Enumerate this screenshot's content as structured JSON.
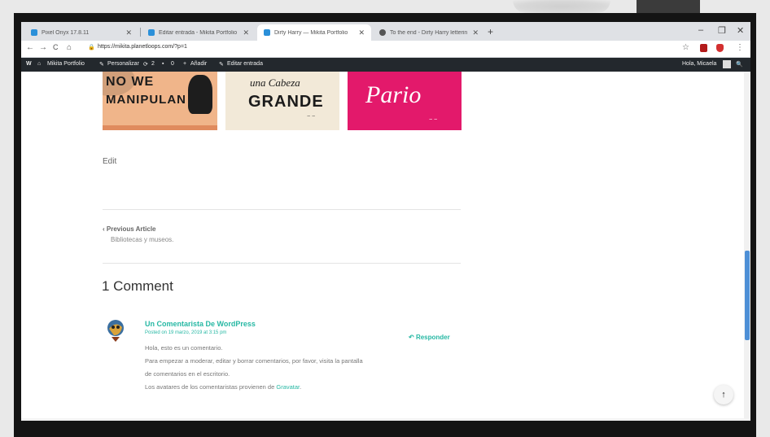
{
  "browser": {
    "tabs": [
      {
        "label": "Pixel Onyx 17.8.11",
        "favicon_color": "#2b90d9"
      },
      {
        "label": "Editar entrada - Mikita Portfolio",
        "favicon_color": "#2b90d9"
      },
      {
        "label": "Dirty Harry — Mikita Portfolio",
        "favicon_color": "#2b90d9"
      },
      {
        "label": "To the end - Dirty Harry lettering",
        "favicon_color": "#555555"
      }
    ],
    "new_tab": "+",
    "window_controls": {
      "minimize": "–",
      "maximize": "❐",
      "close": "✕"
    },
    "nav": {
      "back": "←",
      "forward": "→",
      "reload": "C",
      "home": "⌂"
    },
    "url": "https://mikita.planetloops.com/?p=1",
    "star": "☆"
  },
  "wp_admin_bar": {
    "wp_logo": "W",
    "site_name": "Mikita Portfolio",
    "customize": "Personalizar",
    "updates_count": "2",
    "comments_count": "0",
    "new": "Añadir",
    "edit_post": "Editar entrada",
    "howdy": "Hola, Micaela",
    "search": "🔍"
  },
  "gallery": {
    "tile1_text_line1": "NO WE",
    "tile1_text_line2": "MANIPULAN",
    "tile2_text_line1": "una Cabeza",
    "tile2_text_line2": "GRANDE",
    "tile3_text": "Pario"
  },
  "post": {
    "edit_link": "Edit",
    "previous_label": "Previous Article",
    "previous_title": "Bibliotecas y museos."
  },
  "comments": {
    "heading": "1 Comment",
    "items": [
      {
        "author": "Un Comentarista De WordPress",
        "date": "Posted on 19 marzo, 2019 at 3:15 pm",
        "reply": "Responder",
        "text_line1": "Hola, esto es un comentario.",
        "text_line2": "Para empezar a moderar, editar y borrar comentarios, por favor, visita la pantalla",
        "text_line3": "de comentarios en el escritorio.",
        "text_line4_prefix": "Los avatares de los comentaristas provienen de",
        "text_line4_link": "Gravatar"
      }
    ]
  },
  "back_to_top": "↑",
  "colors": {
    "accent": "#27b8a4",
    "admin_bar": "#23282d",
    "scroll_thumb": "#4d8fd6"
  }
}
